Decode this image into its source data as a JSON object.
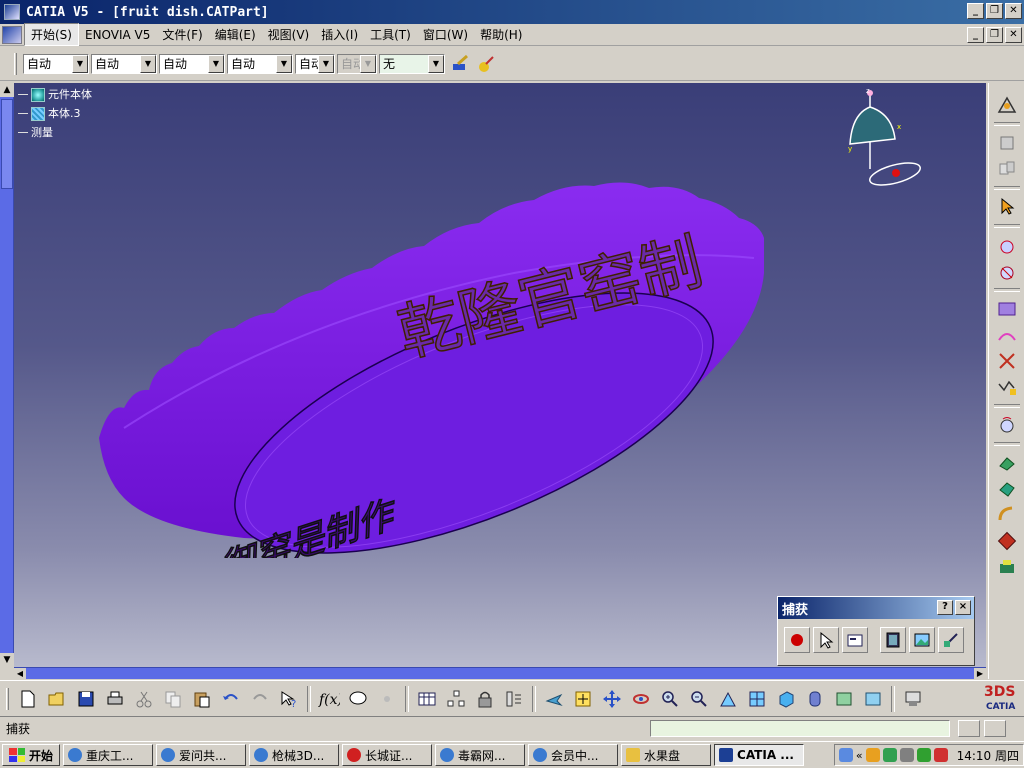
{
  "window": {
    "title": "CATIA V5 - [fruit dish.CATPart]"
  },
  "menu": {
    "items": [
      "开始(S)",
      "ENOVIA V5",
      "文件(F)",
      "编辑(E)",
      "视图(V)",
      "插入(I)",
      "工具(T)",
      "窗口(W)",
      "帮助(H)"
    ]
  },
  "toolbar": {
    "combos": [
      "自动",
      "自动",
      "自动",
      "自动",
      "自动",
      "自动",
      "无"
    ]
  },
  "tree": {
    "items": [
      "元件本体",
      "本体.3",
      "测量"
    ]
  },
  "model": {
    "rim_text": "乾隆官窑制",
    "base_text": "御窑是制作"
  },
  "capture_panel": {
    "title": "捕获",
    "help": "?",
    "close": "×"
  },
  "status": {
    "text": "捕获"
  },
  "taskbar": {
    "start": "开始",
    "buttons": [
      "重庆工...",
      "爱问共...",
      "枪械3D...",
      "长城证...",
      "毒霸网...",
      "会员中...",
      "水果盘",
      "CATIA ..."
    ],
    "clock": "14:10 周四"
  },
  "colors": {
    "model": "#7a1ee6",
    "titlebar": "#0a246a"
  }
}
